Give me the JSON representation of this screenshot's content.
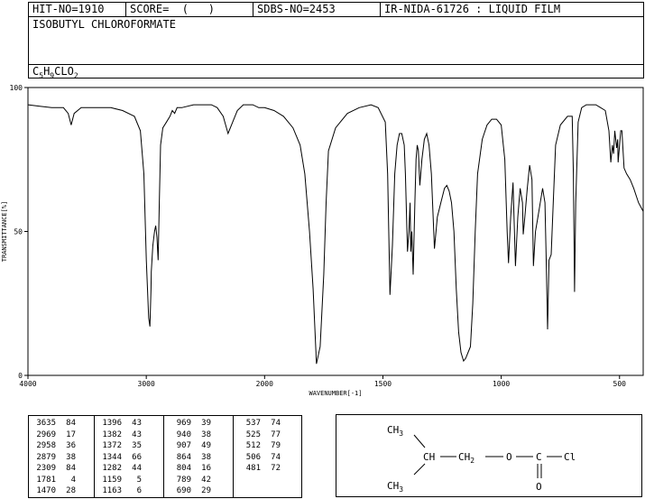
{
  "header": {
    "hit_no": "HIT-NO=1910",
    "score": "SCORE=  (   )",
    "sdbs_no": "SDBS-NO=2453",
    "ir_code": "IR-NIDA-61726 : LIQUID FILM",
    "compound": "ISOBUTYL CHLOROFORMATE",
    "formula_parts": [
      "C",
      "5",
      "H",
      "9",
      "CLO",
      "2"
    ]
  },
  "chart_data": {
    "type": "line",
    "title": "",
    "xlabel": "WAVENUMBER[-1]",
    "ylabel": "TRANSMITTANCE[%]",
    "xlim": [
      4000,
      400
    ],
    "ylim": [
      0,
      100
    ],
    "x_ticks": [
      4000,
      3000,
      2000,
      1500,
      1000,
      500
    ],
    "y_ticks": [
      0,
      50,
      100
    ],
    "grid": false,
    "series": [
      {
        "values": [
          [
            4000,
            94
          ],
          [
            3900,
            93.5
          ],
          [
            3800,
            93
          ],
          [
            3700,
            93
          ],
          [
            3660,
            91
          ],
          [
            3635,
            87
          ],
          [
            3610,
            91
          ],
          [
            3550,
            93
          ],
          [
            3400,
            93
          ],
          [
            3300,
            93
          ],
          [
            3200,
            92
          ],
          [
            3100,
            90
          ],
          [
            3050,
            85
          ],
          [
            3020,
            70
          ],
          [
            3000,
            40
          ],
          [
            2980,
            20
          ],
          [
            2969,
            17
          ],
          [
            2960,
            30
          ],
          [
            2958,
            36
          ],
          [
            2945,
            45
          ],
          [
            2930,
            50
          ],
          [
            2920,
            52
          ],
          [
            2910,
            48
          ],
          [
            2900,
            40
          ],
          [
            2890,
            60
          ],
          [
            2879,
            80
          ],
          [
            2860,
            86
          ],
          [
            2830,
            88
          ],
          [
            2800,
            90
          ],
          [
            2780,
            92
          ],
          [
            2760,
            91
          ],
          [
            2740,
            93
          ],
          [
            2700,
            93
          ],
          [
            2600,
            94
          ],
          [
            2500,
            94
          ],
          [
            2450,
            94
          ],
          [
            2400,
            93
          ],
          [
            2350,
            90
          ],
          [
            2309,
            84
          ],
          [
            2270,
            88
          ],
          [
            2230,
            92
          ],
          [
            2180,
            94
          ],
          [
            2100,
            94
          ],
          [
            2050,
            93
          ],
          [
            2000,
            93
          ],
          [
            1960,
            92
          ],
          [
            1920,
            90
          ],
          [
            1880,
            86
          ],
          [
            1850,
            80
          ],
          [
            1830,
            70
          ],
          [
            1810,
            50
          ],
          [
            1795,
            30
          ],
          [
            1781,
            4
          ],
          [
            1765,
            10
          ],
          [
            1750,
            35
          ],
          [
            1740,
            60
          ],
          [
            1730,
            78
          ],
          [
            1700,
            86
          ],
          [
            1680,
            88
          ],
          [
            1650,
            91
          ],
          [
            1600,
            93
          ],
          [
            1550,
            94
          ],
          [
            1520,
            93
          ],
          [
            1490,
            88
          ],
          [
            1480,
            70
          ],
          [
            1470,
            28
          ],
          [
            1460,
            45
          ],
          [
            1450,
            70
          ],
          [
            1440,
            80
          ],
          [
            1430,
            84
          ],
          [
            1420,
            84
          ],
          [
            1410,
            80
          ],
          [
            1405,
            70
          ],
          [
            1396,
            43
          ],
          [
            1390,
            50
          ],
          [
            1385,
            60
          ],
          [
            1382,
            43
          ],
          [
            1378,
            50
          ],
          [
            1372,
            35
          ],
          [
            1365,
            60
          ],
          [
            1360,
            75
          ],
          [
            1355,
            80
          ],
          [
            1350,
            78
          ],
          [
            1344,
            66
          ],
          [
            1335,
            75
          ],
          [
            1325,
            82
          ],
          [
            1315,
            84
          ],
          [
            1305,
            80
          ],
          [
            1295,
            70
          ],
          [
            1282,
            44
          ],
          [
            1270,
            55
          ],
          [
            1255,
            60
          ],
          [
            1240,
            65
          ],
          [
            1230,
            66
          ],
          [
            1220,
            64
          ],
          [
            1210,
            60
          ],
          [
            1200,
            50
          ],
          [
            1190,
            30
          ],
          [
            1180,
            15
          ],
          [
            1170,
            8
          ],
          [
            1163,
            6
          ],
          [
            1159,
            5
          ],
          [
            1150,
            6
          ],
          [
            1140,
            8
          ],
          [
            1130,
            10
          ],
          [
            1120,
            25
          ],
          [
            1110,
            50
          ],
          [
            1100,
            70
          ],
          [
            1080,
            82
          ],
          [
            1060,
            87
          ],
          [
            1040,
            89
          ],
          [
            1020,
            89
          ],
          [
            1000,
            87
          ],
          [
            985,
            75
          ],
          [
            975,
            50
          ],
          [
            969,
            39
          ],
          [
            960,
            55
          ],
          [
            950,
            67
          ],
          [
            940,
            38
          ],
          [
            930,
            55
          ],
          [
            920,
            65
          ],
          [
            910,
            60
          ],
          [
            907,
            49
          ],
          [
            900,
            55
          ],
          [
            890,
            65
          ],
          [
            880,
            73
          ],
          [
            870,
            68
          ],
          [
            864,
            38
          ],
          [
            855,
            50
          ],
          [
            845,
            55
          ],
          [
            835,
            60
          ],
          [
            825,
            65
          ],
          [
            815,
            60
          ],
          [
            810,
            40
          ],
          [
            804,
            16
          ],
          [
            798,
            40
          ],
          [
            789,
            42
          ],
          [
            780,
            60
          ],
          [
            770,
            80
          ],
          [
            750,
            87
          ],
          [
            720,
            90
          ],
          [
            700,
            90
          ],
          [
            695,
            70
          ],
          [
            690,
            29
          ],
          [
            685,
            60
          ],
          [
            675,
            88
          ],
          [
            660,
            93
          ],
          [
            640,
            94
          ],
          [
            620,
            94
          ],
          [
            600,
            94
          ],
          [
            580,
            93
          ],
          [
            560,
            92
          ],
          [
            545,
            85
          ],
          [
            537,
            74
          ],
          [
            530,
            80
          ],
          [
            525,
            77
          ],
          [
            520,
            85
          ],
          [
            512,
            79
          ],
          [
            508,
            82
          ],
          [
            506,
            74
          ],
          [
            500,
            80
          ],
          [
            495,
            85
          ],
          [
            490,
            85
          ],
          [
            481,
            72
          ],
          [
            470,
            70
          ],
          [
            455,
            68
          ],
          [
            440,
            65
          ],
          [
            420,
            60
          ],
          [
            400,
            57
          ]
        ]
      }
    ],
    "peak_table": {
      "columns": [
        [
          [
            "3635",
            "84"
          ],
          [
            "2969",
            "17"
          ],
          [
            "2958",
            "36"
          ],
          [
            "2879",
            "38"
          ],
          [
            "2309",
            "84"
          ],
          [
            "1781",
            "4"
          ],
          [
            "1470",
            "28"
          ]
        ],
        [
          [
            "1396",
            "43"
          ],
          [
            "1382",
            "43"
          ],
          [
            "1372",
            "35"
          ],
          [
            "1344",
            "66"
          ],
          [
            "1282",
            "44"
          ],
          [
            "1159",
            "5"
          ],
          [
            "1163",
            "6"
          ]
        ],
        [
          [
            "969",
            "39"
          ],
          [
            "940",
            "38"
          ],
          [
            "907",
            "49"
          ],
          [
            "864",
            "38"
          ],
          [
            "804",
            "16"
          ],
          [
            "789",
            "42"
          ],
          [
            "690",
            "29"
          ]
        ],
        [
          [
            "537",
            "74"
          ],
          [
            "525",
            "77"
          ],
          [
            "512",
            "79"
          ],
          [
            "506",
            "74"
          ],
          [
            "481",
            "72"
          ]
        ]
      ]
    }
  },
  "structure": {
    "ch3_top": "CH",
    "ch3_top_sub": "3",
    "ch3_bottom": "CH",
    "ch3_bottom_sub": "3",
    "ch": "CH",
    "ch2": "CH",
    "ch2_sub": "2",
    "o_ether": "O",
    "c_carbonyl": "C",
    "cl": "Cl",
    "o_carbonyl": "O"
  }
}
